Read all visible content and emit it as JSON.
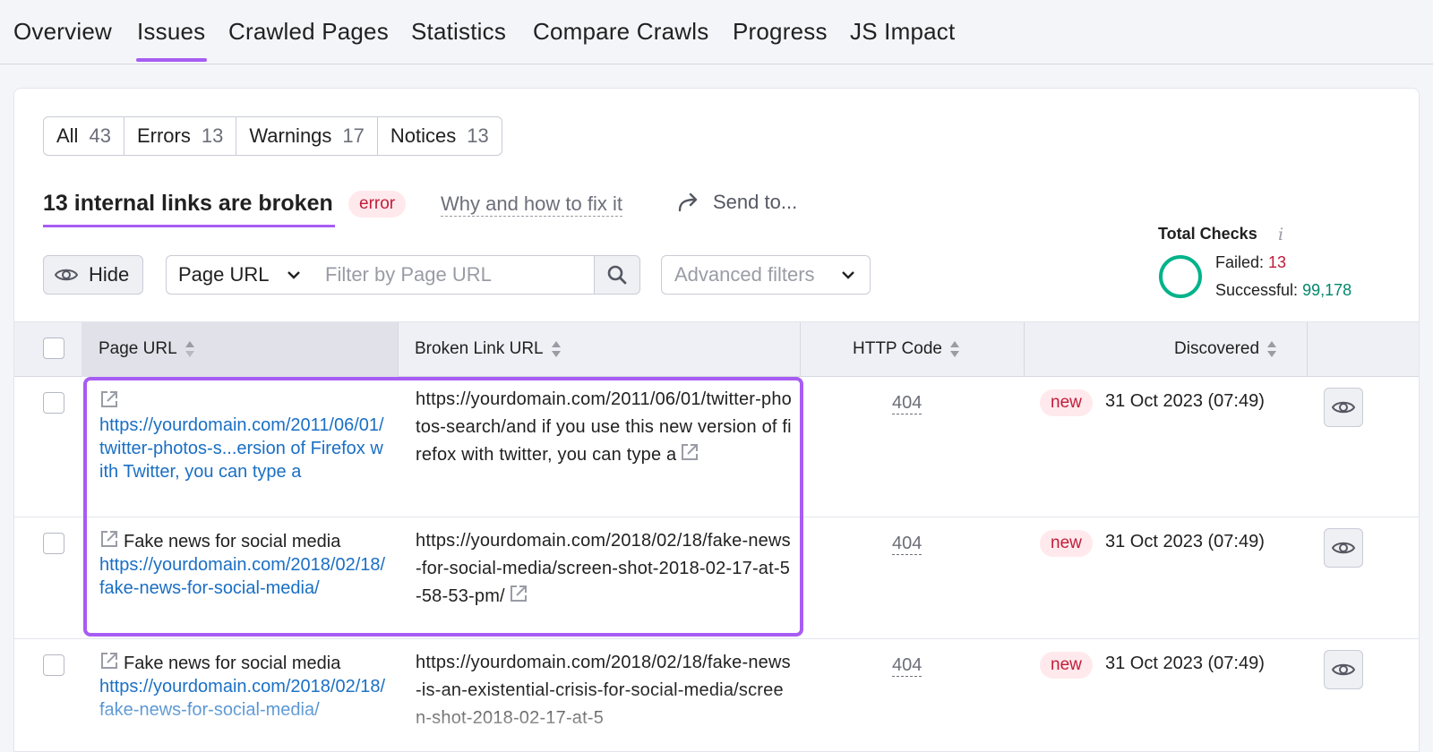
{
  "tabs": [
    {
      "label": "Overview"
    },
    {
      "label": "Issues"
    },
    {
      "label": "Crawled Pages"
    },
    {
      "label": "Statistics"
    },
    {
      "label": "Compare Crawls"
    },
    {
      "label": "Progress"
    },
    {
      "label": "JS Impact"
    }
  ],
  "active_tab": "Issues",
  "issue_filter": [
    {
      "label": "All",
      "count": "43"
    },
    {
      "label": "Errors",
      "count": "13"
    },
    {
      "label": "Warnings",
      "count": "17"
    },
    {
      "label": "Notices",
      "count": "13"
    }
  ],
  "issue": {
    "title": "13 internal links are broken",
    "badge": "error",
    "fix_link": "Why and how to fix it",
    "send_to": "Send to..."
  },
  "controls": {
    "hide_label": "Hide",
    "url_select": "Page URL",
    "filter_placeholder": "Filter by Page URL",
    "advanced_filters": "Advanced filters"
  },
  "total_checks": {
    "title": "Total Checks",
    "info": "i",
    "failed_label": "Failed:",
    "failed_value": "13",
    "successful_label": "Successful:",
    "successful_value": "99,178"
  },
  "table": {
    "columns": [
      "Page URL",
      "Broken Link URL",
      "HTTP Code",
      "Discovered"
    ],
    "rows": [
      {
        "page_title": "",
        "page_url": "https://yourdomain.com/2011/06/01/twitter-photos-s...ersion of Firefox with Twitter, you can type a",
        "broken_url": "https://yourdomain.com/2011/06/01/twitter-photos-search/and if you use this new version of firefox with twitter, you can type a",
        "http_code": "404",
        "badge": "new",
        "discovered": "31 Oct 2023 (07:49)"
      },
      {
        "page_title": "Fake news for social media",
        "page_url": "https://yourdomain.com/2018/02/18/fake-news-for-social-media/",
        "broken_url": "https://yourdomain.com/2018/02/18/fake-news-for-social-media/screen-shot-2018-02-17-at-5-58-53-pm/",
        "http_code": "404",
        "badge": "new",
        "discovered": "31 Oct 2023 (07:49)"
      },
      {
        "page_title": "Fake news for social media",
        "page_url": "https://yourdomain.com/2018/02/18/fake-news-for-social-media/",
        "broken_url": "https://yourdomain.com/2018/02/18/fake-news-is-an-existential-crisis-for-social-media/screen-shot-2018-02-17-at-5",
        "http_code": "404",
        "badge": "new",
        "discovered": "31 Oct 2023 (07:49)"
      }
    ]
  },
  "colors": {
    "accent": "#a75cf3",
    "error": "#c01d3a",
    "success": "#00866b",
    "link": "#1a6fc4"
  }
}
